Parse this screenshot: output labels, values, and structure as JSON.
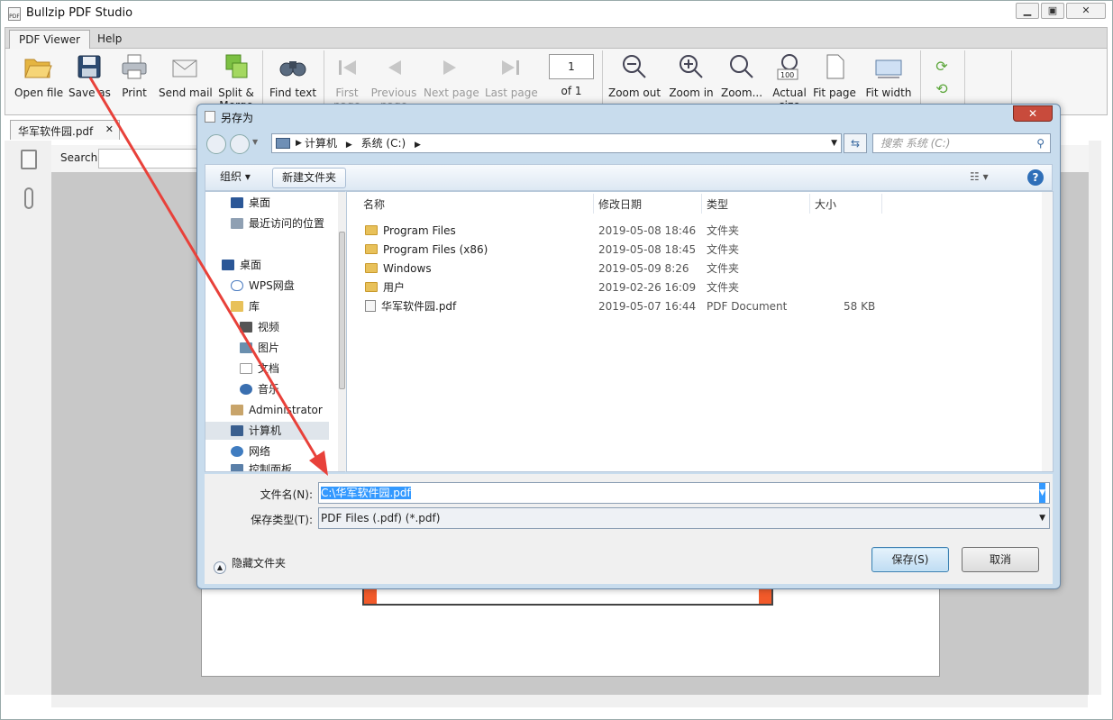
{
  "app": {
    "title": "Bullzip PDF Studio"
  },
  "menu": {
    "tabs": [
      "PDF Viewer",
      "Help"
    ]
  },
  "toolbar": {
    "open": "Open file",
    "save": "Save as",
    "print": "Print",
    "send": "Send mail",
    "split": "Split &",
    "split2": "Merge",
    "find": "Find text",
    "first": "First",
    "first2": "page",
    "previous": "Previous",
    "previous2": "page",
    "next": "Next page",
    "last": "Last page",
    "page_value": "1",
    "of": "of 1",
    "zoom_out": "Zoom out",
    "zoom_in": "Zoom in",
    "zoom": "Zoom...",
    "actual": "Actual",
    "actual2": "size",
    "fit_page": "Fit page",
    "fit_width": "Fit width",
    "actual_icon_text": "100"
  },
  "doc_tab": {
    "name": "华军软件园.pdf",
    "close": "✕"
  },
  "search": {
    "label": "Search"
  },
  "dialog": {
    "title": "另存为",
    "close": "✕",
    "breadcrumb": [
      "计算机",
      "系统 (C:)"
    ],
    "search_placeholder": "搜索 系统 (C:)",
    "organize": "组织 ▾",
    "new_folder": "新建文件夹",
    "nav": [
      "桌面",
      "最近访问的位置",
      "桌面",
      "WPS网盘",
      "库",
      "视频",
      "图片",
      "文档",
      "音乐",
      "Administrator",
      "计算机",
      "网络",
      "控制面板"
    ],
    "columns": [
      "名称",
      "修改日期",
      "类型",
      "大小"
    ],
    "files": [
      {
        "name": "Program Files",
        "date": "2019-05-08 18:46",
        "type": "文件夹",
        "size": ""
      },
      {
        "name": "Program Files (x86)",
        "date": "2019-05-08 18:45",
        "type": "文件夹",
        "size": ""
      },
      {
        "name": "Windows",
        "date": "2019-05-09 8:26",
        "type": "文件夹",
        "size": ""
      },
      {
        "name": "用户",
        "date": "2019-02-26 16:09",
        "type": "文件夹",
        "size": ""
      },
      {
        "name": "华军软件园.pdf",
        "date": "2019-05-07 16:44",
        "type": "PDF Document",
        "size": "58 KB"
      }
    ],
    "filename_label": "文件名(N):",
    "filename_value": "C:\\华军软件园.pdf",
    "filetype_label": "保存类型(T):",
    "filetype_value": "PDF Files (.pdf) (*.pdf)",
    "hide_folders": "隐藏文件夹",
    "save": "保存(S)",
    "cancel": "取消"
  },
  "colors": {
    "annotation_arrow": "#e8413a",
    "accent_selection": "#3399ff"
  }
}
